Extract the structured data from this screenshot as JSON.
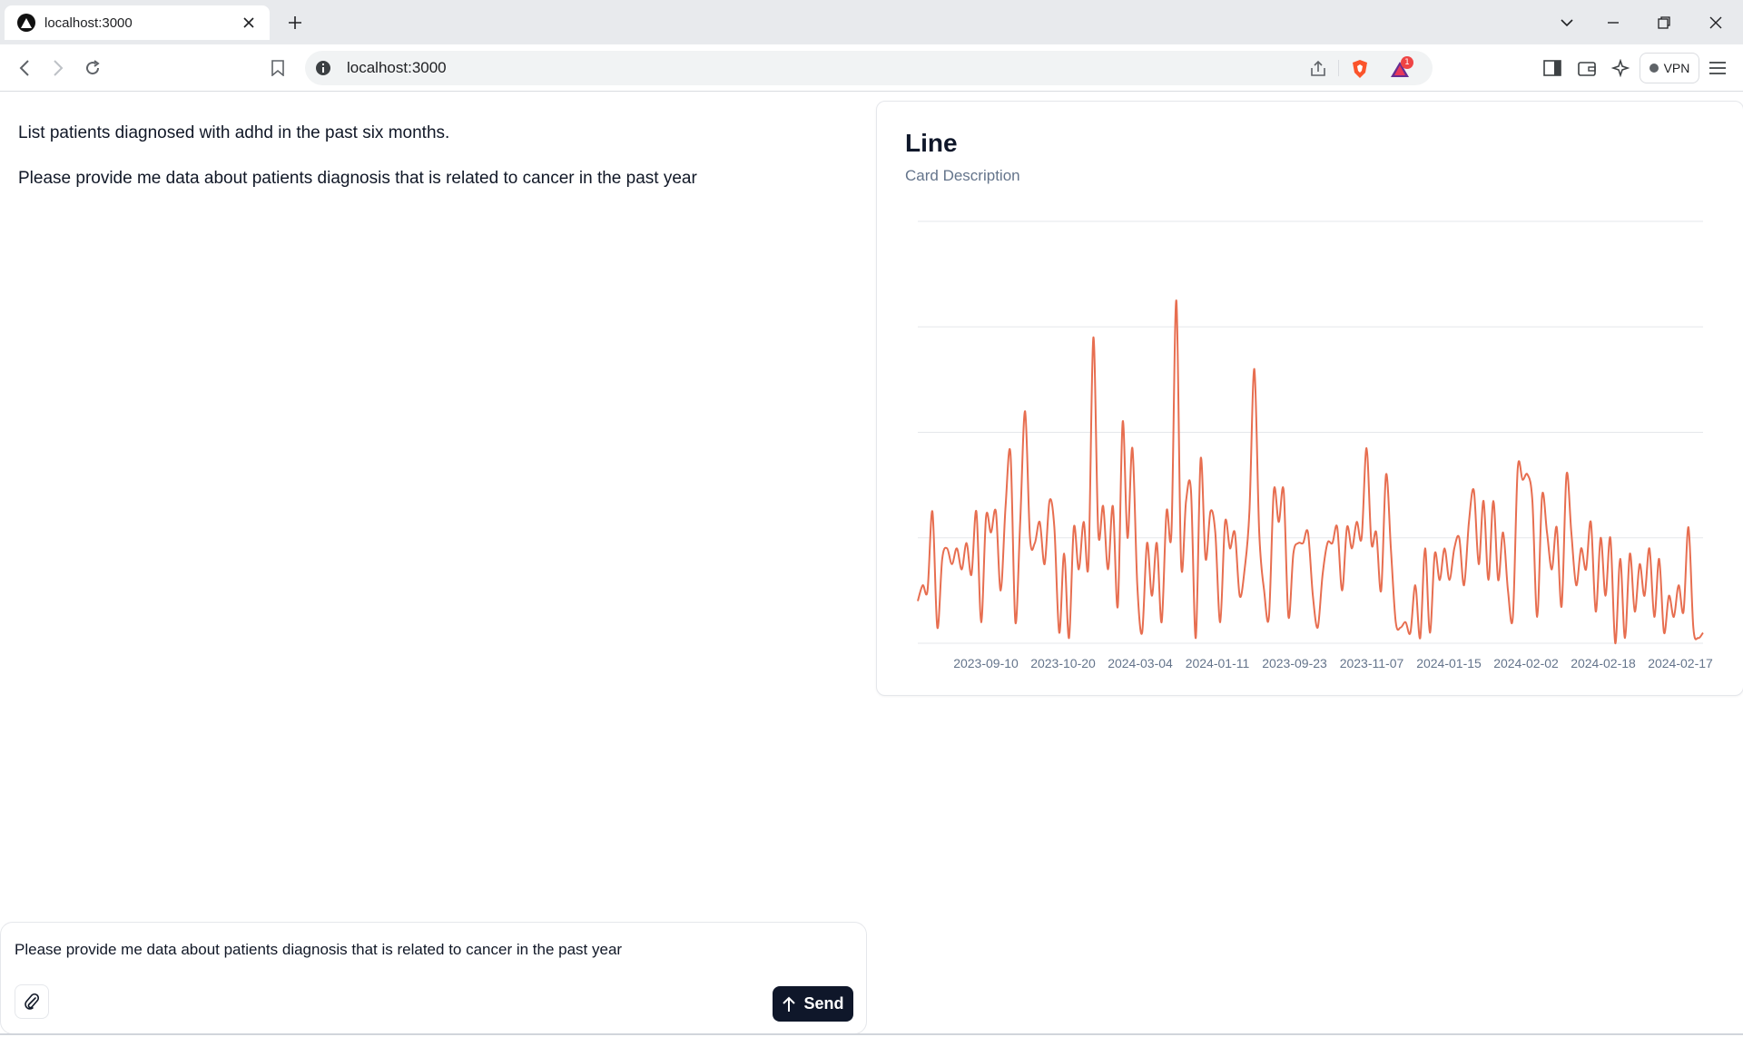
{
  "browser": {
    "tab_title": "localhost:3000",
    "url": "localhost:3000",
    "notification_count": "1",
    "vpn_label": "VPN",
    "icons": [
      "logo-icon",
      "close-icon",
      "plus-icon",
      "chevron-down-icon",
      "minimize-icon",
      "restore-icon",
      "window-close-icon",
      "back-icon",
      "forward-icon",
      "reload-icon",
      "bookmark-icon",
      "info-icon",
      "share-icon",
      "brave-shield-icon",
      "brave-rewards-icon",
      "sidebar-icon",
      "wallet-icon",
      "leo-icon",
      "menu-icon"
    ]
  },
  "messages": [
    "List patients diagnosed with adhd in the past six months.",
    "Please provide me data about patients diagnosis that is related to cancer in the past year"
  ],
  "card": {
    "title": "Line",
    "description": "Card Description"
  },
  "composer": {
    "value": "Please provide me data about patients diagnosis that is related to cancer in the past year",
    "send_label": "Send"
  },
  "colors": {
    "line": "#e76e50",
    "grid": "#e5e7eb",
    "tick_text": "#64748b",
    "send_bg": "#0f172a"
  },
  "chart_data": {
    "type": "line",
    "title": "Line",
    "subtitle": "Card Description",
    "xlabel": "",
    "ylabel": "",
    "grid": "horizontal",
    "smooth": true,
    "ylim": [
      0,
      4
    ],
    "x_tick_labels": [
      "2023-09-10",
      "2023-10-20",
      "2024-03-04",
      "2024-01-11",
      "2023-09-23",
      "2023-11-07",
      "2024-01-15",
      "2024-02-02",
      "2024-02-18",
      "2024-02-17"
    ],
    "values": [
      0.4,
      0.55,
      0.5,
      1.25,
      0.15,
      0.8,
      0.9,
      0.75,
      0.9,
      0.7,
      0.95,
      0.65,
      1.25,
      0.2,
      1.2,
      1.05,
      1.25,
      0.5,
      1.3,
      1.8,
      0.2,
      1.15,
      2.2,
      1.0,
      0.95,
      1.15,
      0.75,
      1.35,
      1.1,
      0.1,
      0.85,
      0.05,
      1.1,
      0.7,
      1.15,
      0.75,
      2.9,
      1.05,
      1.3,
      0.7,
      1.3,
      0.35,
      2.1,
      1.0,
      1.85,
      0.55,
      0.1,
      0.95,
      0.45,
      0.95,
      0.2,
      1.25,
      1.05,
      3.25,
      0.75,
      1.35,
      1.45,
      0.05,
      1.75,
      0.8,
      1.25,
      1.05,
      0.2,
      1.15,
      0.9,
      1.05,
      0.45,
      0.7,
      1.25,
      2.6,
      1.05,
      0.5,
      0.25,
      1.45,
      1.15,
      1.45,
      0.25,
      0.85,
      0.95,
      0.95,
      1.05,
      0.45,
      0.15,
      0.65,
      0.95,
      0.95,
      1.1,
      0.5,
      1.1,
      0.9,
      1.15,
      1.0,
      1.85,
      0.95,
      1.05,
      0.5,
      1.6,
      0.9,
      0.2,
      0.15,
      0.2,
      0.1,
      0.55,
      0.05,
      0.9,
      0.1,
      0.85,
      0.6,
      0.9,
      0.6,
      0.9,
      1.0,
      0.55,
      1.15,
      1.45,
      0.75,
      1.35,
      0.6,
      1.35,
      0.6,
      1.05,
      0.5,
      0.25,
      1.65,
      1.55,
      1.6,
      1.35,
      0.25,
      1.4,
      1.05,
      0.7,
      1.1,
      0.35,
      1.6,
      1.05,
      0.55,
      0.9,
      0.7,
      1.15,
      0.3,
      1.0,
      0.45,
      1.0,
      0.0,
      0.8,
      0.05,
      0.85,
      0.3,
      0.75,
      0.45,
      0.9,
      0.25,
      0.8,
      0.1,
      0.45,
      0.25,
      0.55,
      0.3,
      1.1,
      0.15,
      0.05,
      0.1
    ]
  }
}
